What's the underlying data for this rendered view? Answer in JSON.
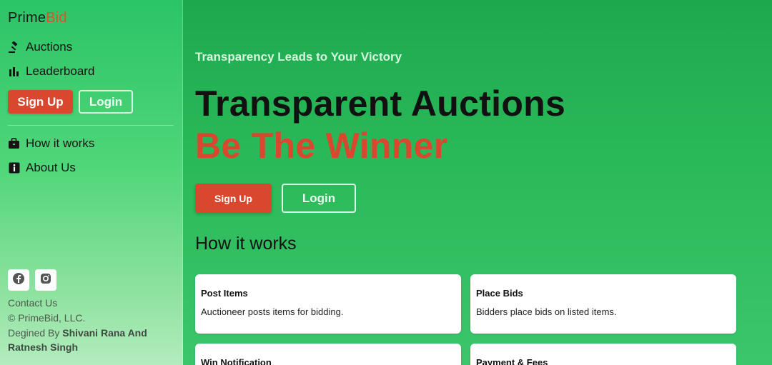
{
  "brand": {
    "name_prefix": "Prime",
    "name_accent": "Bid"
  },
  "sidebar": {
    "nav_top": [
      {
        "label": "Auctions",
        "icon": "gavel-icon"
      },
      {
        "label": "Leaderboard",
        "icon": "bar-chart-icon"
      }
    ],
    "signup_label": "Sign Up",
    "login_label": "Login",
    "nav_bottom": [
      {
        "label": "How it works",
        "icon": "briefcase-icon"
      },
      {
        "label": "About Us",
        "icon": "info-icon"
      }
    ],
    "social": [
      "facebook-icon",
      "instagram-icon"
    ],
    "footer": {
      "contact": "Contact Us",
      "copyright": "© PrimeBid, LLC.",
      "designed_prefix": "Degined By ",
      "designed_names_1": "Shivani Rana And",
      "designed_names_2": "Ratnesh Singh"
    }
  },
  "main": {
    "tagline": "Transparency Leads to Your Victory",
    "hero_line_1": "Transparent Auctions",
    "hero_line_2": "Be The Winner",
    "signup_label": "Sign Up",
    "login_label": "Login",
    "how_title": "How it works",
    "cards": [
      {
        "title": "Post Items",
        "desc": "Auctioneer posts items for bidding."
      },
      {
        "title": "Place Bids",
        "desc": "Bidders place bids on listed items."
      },
      {
        "title": "Win Notification",
        "desc": ""
      },
      {
        "title": "Payment & Fees",
        "desc": ""
      }
    ]
  },
  "colors": {
    "accent": "#d9482e",
    "green": "#29b858"
  }
}
